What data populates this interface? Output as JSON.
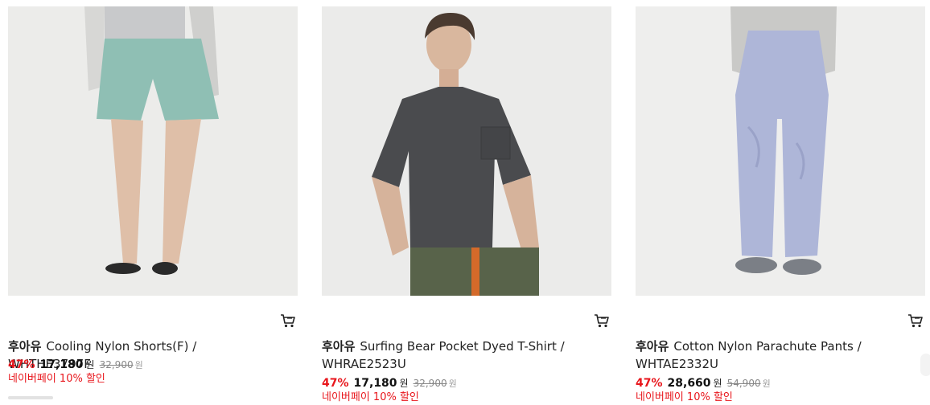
{
  "products": [
    {
      "image_alt": "Cooling Nylon Shorts",
      "brand": "후아유",
      "name": "Cooling Nylon Shorts(F) / WHTHE3797F",
      "discount_rate": "47%",
      "price": "17,180",
      "currency": "원",
      "original_price": "32,900",
      "original_currency": "원",
      "promo": "네이버페이 10% 할인"
    },
    {
      "image_alt": "Surfing Bear Pocket Dyed T-Shirt",
      "brand": "후아유",
      "name": "Surfing Bear Pocket Dyed T-Shirt / WHRAE2523U",
      "discount_rate": "47%",
      "price": "17,180",
      "currency": "원",
      "original_price": "32,900",
      "original_currency": "원",
      "promo": "네이버페이 10% 할인"
    },
    {
      "image_alt": "Cotton Nylon Parachute Pants",
      "brand": "후아유",
      "name": "Cotton Nylon Parachute Pants / WHTAE2332U",
      "discount_rate": "47%",
      "price": "28,660",
      "currency": "원",
      "original_price": "54,900",
      "original_currency": "원",
      "promo": "네이버페이 10% 할인"
    }
  ],
  "icons": {
    "cart": "cart-icon"
  },
  "colors": {
    "discount": "#e8161c",
    "promo": "#e8161c"
  }
}
